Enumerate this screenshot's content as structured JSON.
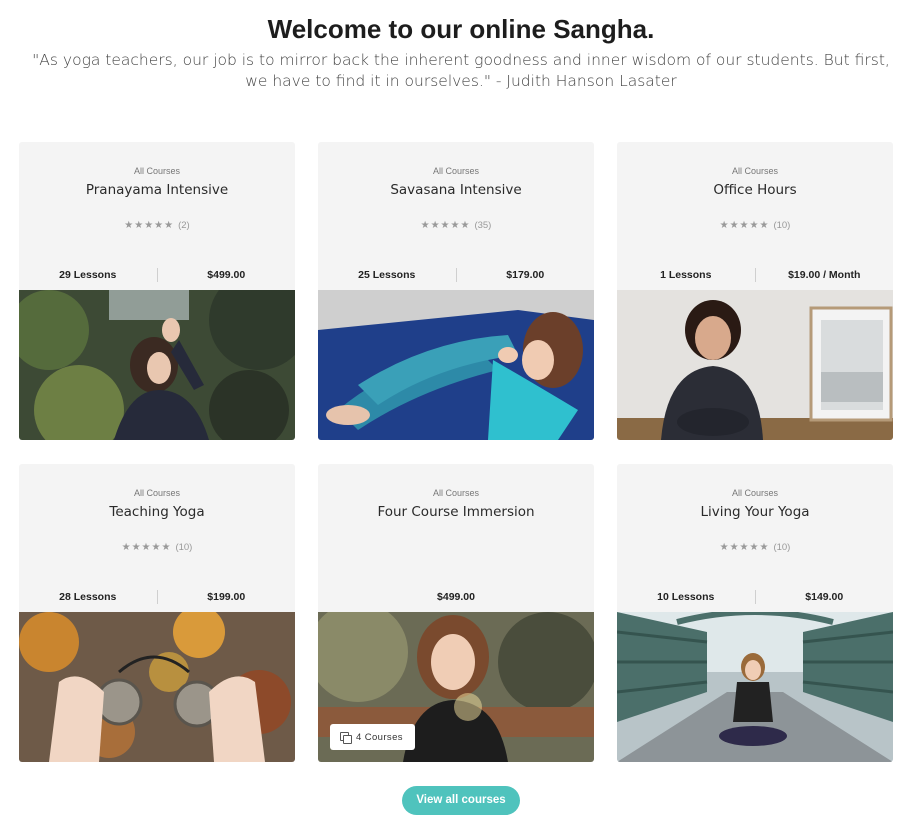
{
  "header": {
    "title": "Welcome to our online Sangha.",
    "quote": "\"As yoga teachers, our job is to mirror back the inherent goodness and inner wisdom of our students. But first, we have to find it in ourselves.\" - Judith Hanson Lasater"
  },
  "courses": [
    {
      "category": "All Courses",
      "name": "Pranayama Intensive",
      "stars": "★★★★★",
      "rating_count": "(2)",
      "lessons": "29 Lessons",
      "price": "$499.00",
      "image": "woman-praying-forest"
    },
    {
      "category": "All Courses",
      "name": "Savasana Intensive",
      "stars": "★★★★★",
      "rating_count": "(35)",
      "lessons": "25 Lessons",
      "price": "$179.00",
      "image": "two-women-on-mat"
    },
    {
      "category": "All Courses",
      "name": "Office Hours",
      "stars": "★★★★★",
      "rating_count": "(10)",
      "lessons": "1 Lessons",
      "price": "$19.00 / Month",
      "image": "teacher-seated-portrait"
    },
    {
      "category": "All Courses",
      "name": "Teaching Yoga",
      "stars": "★★★★★",
      "rating_count": "(10)",
      "lessons": "28 Lessons",
      "price": "$199.00",
      "image": "hands-with-cymbals"
    },
    {
      "category": "All Courses",
      "name": "Four Course Immersion",
      "price": "$499.00",
      "badge": "4 Courses",
      "image": "smiling-woman-outdoors"
    },
    {
      "category": "All Courses",
      "name": "Living Your Yoga",
      "stars": "★★★★★",
      "rating_count": "(10)",
      "lessons": "10 Lessons",
      "price": "$149.00",
      "image": "woman-meditating-on-bridge"
    }
  ],
  "cta": {
    "label": "View all courses"
  },
  "colors": {
    "accent": "#4fc3bd",
    "card_bg": "#f4f4f4"
  }
}
